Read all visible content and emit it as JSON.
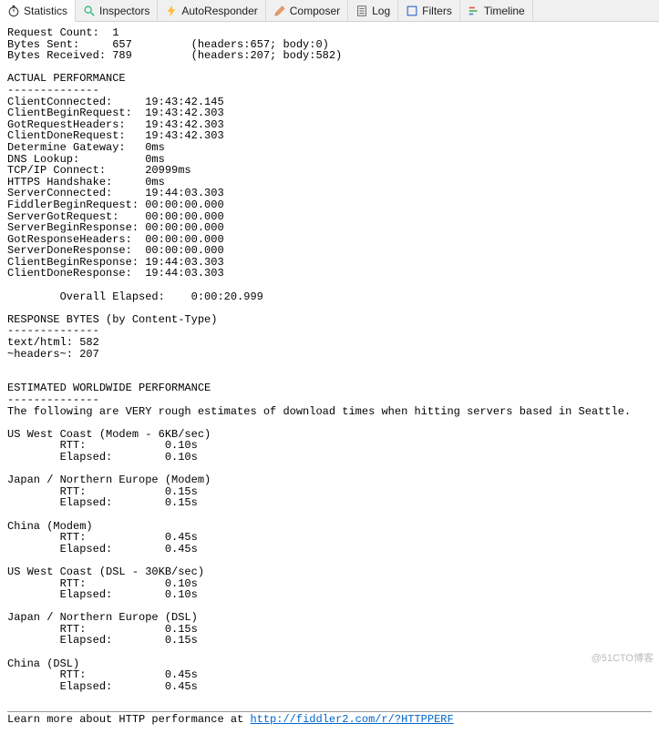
{
  "tabs": [
    {
      "id": "statistics",
      "label": "Statistics",
      "active": true
    },
    {
      "id": "inspectors",
      "label": "Inspectors",
      "active": false
    },
    {
      "id": "autoresponder",
      "label": "AutoResponder",
      "active": false
    },
    {
      "id": "composer",
      "label": "Composer",
      "active": false
    },
    {
      "id": "log",
      "label": "Log",
      "active": false
    },
    {
      "id": "filters",
      "label": "Filters",
      "active": false
    },
    {
      "id": "timeline",
      "label": "Timeline",
      "active": false
    }
  ],
  "summary": {
    "request_count_label": "Request Count:",
    "request_count": "1",
    "bytes_sent_label": "Bytes Sent:",
    "bytes_sent": "657",
    "bytes_sent_detail": "(headers:657; body:0)",
    "bytes_received_label": "Bytes Received:",
    "bytes_received": "789",
    "bytes_received_detail": "(headers:207; body:582)"
  },
  "actual_perf": {
    "heading": "ACTUAL PERFORMANCE",
    "sep": "--------------",
    "rows": [
      {
        "k": "ClientConnected:",
        "v": "19:43:42.145"
      },
      {
        "k": "ClientBeginRequest:",
        "v": "19:43:42.303"
      },
      {
        "k": "GotRequestHeaders:",
        "v": "19:43:42.303"
      },
      {
        "k": "ClientDoneRequest:",
        "v": "19:43:42.303"
      },
      {
        "k": "Determine Gateway:",
        "v": "0ms"
      },
      {
        "k": "DNS Lookup:",
        "v": "0ms"
      },
      {
        "k": "TCP/IP Connect:",
        "v": "20999ms"
      },
      {
        "k": "HTTPS Handshake:",
        "v": "0ms"
      },
      {
        "k": "ServerConnected:",
        "v": "19:44:03.303"
      },
      {
        "k": "FiddlerBeginRequest:",
        "v": "00:00:00.000"
      },
      {
        "k": "ServerGotRequest:",
        "v": "00:00:00.000"
      },
      {
        "k": "ServerBeginResponse:",
        "v": "00:00:00.000"
      },
      {
        "k": "GotResponseHeaders:",
        "v": "00:00:00.000"
      },
      {
        "k": "ServerDoneResponse:",
        "v": "00:00:00.000"
      },
      {
        "k": "ClientBeginResponse:",
        "v": "19:44:03.303"
      },
      {
        "k": "ClientDoneResponse:",
        "v": "19:44:03.303"
      }
    ],
    "overall_label": "Overall Elapsed:",
    "overall_value": "0:00:20.999"
  },
  "response_bytes": {
    "heading": "RESPONSE BYTES (by Content-Type)",
    "sep": "--------------",
    "rows": [
      {
        "k": "text/html:",
        "v": "582"
      },
      {
        "k": "~headers~:",
        "v": "207"
      }
    ]
  },
  "est_perf": {
    "heading": "ESTIMATED WORLDWIDE PERFORMANCE",
    "sep": "--------------",
    "note": "The following are VERY rough estimates of download times when hitting servers based in Seattle.",
    "regions": [
      {
        "title": "US West Coast (Modem - 6KB/sec)",
        "rtt": "0.10s",
        "elapsed": "0.10s"
      },
      {
        "title": "Japan / Northern Europe (Modem)",
        "rtt": "0.15s",
        "elapsed": "0.15s"
      },
      {
        "title": "China (Modem)",
        "rtt": "0.45s",
        "elapsed": "0.45s"
      },
      {
        "title": "US West Coast (DSL - 30KB/sec)",
        "rtt": "0.10s",
        "elapsed": "0.10s"
      },
      {
        "title": "Japan / Northern Europe (DSL)",
        "rtt": "0.15s",
        "elapsed": "0.15s"
      },
      {
        "title": "China (DSL)",
        "rtt": "0.45s",
        "elapsed": "0.45s"
      }
    ],
    "rtt_label": "RTT:",
    "elapsed_label": "Elapsed:"
  },
  "footer": {
    "text": "Learn more about HTTP performance at ",
    "link_text": "http://fiddler2.com/r/?HTTPPERF",
    "link_href": "http://fiddler2.com/r/?HTTPPERF"
  },
  "watermark": "@51CTO博客"
}
